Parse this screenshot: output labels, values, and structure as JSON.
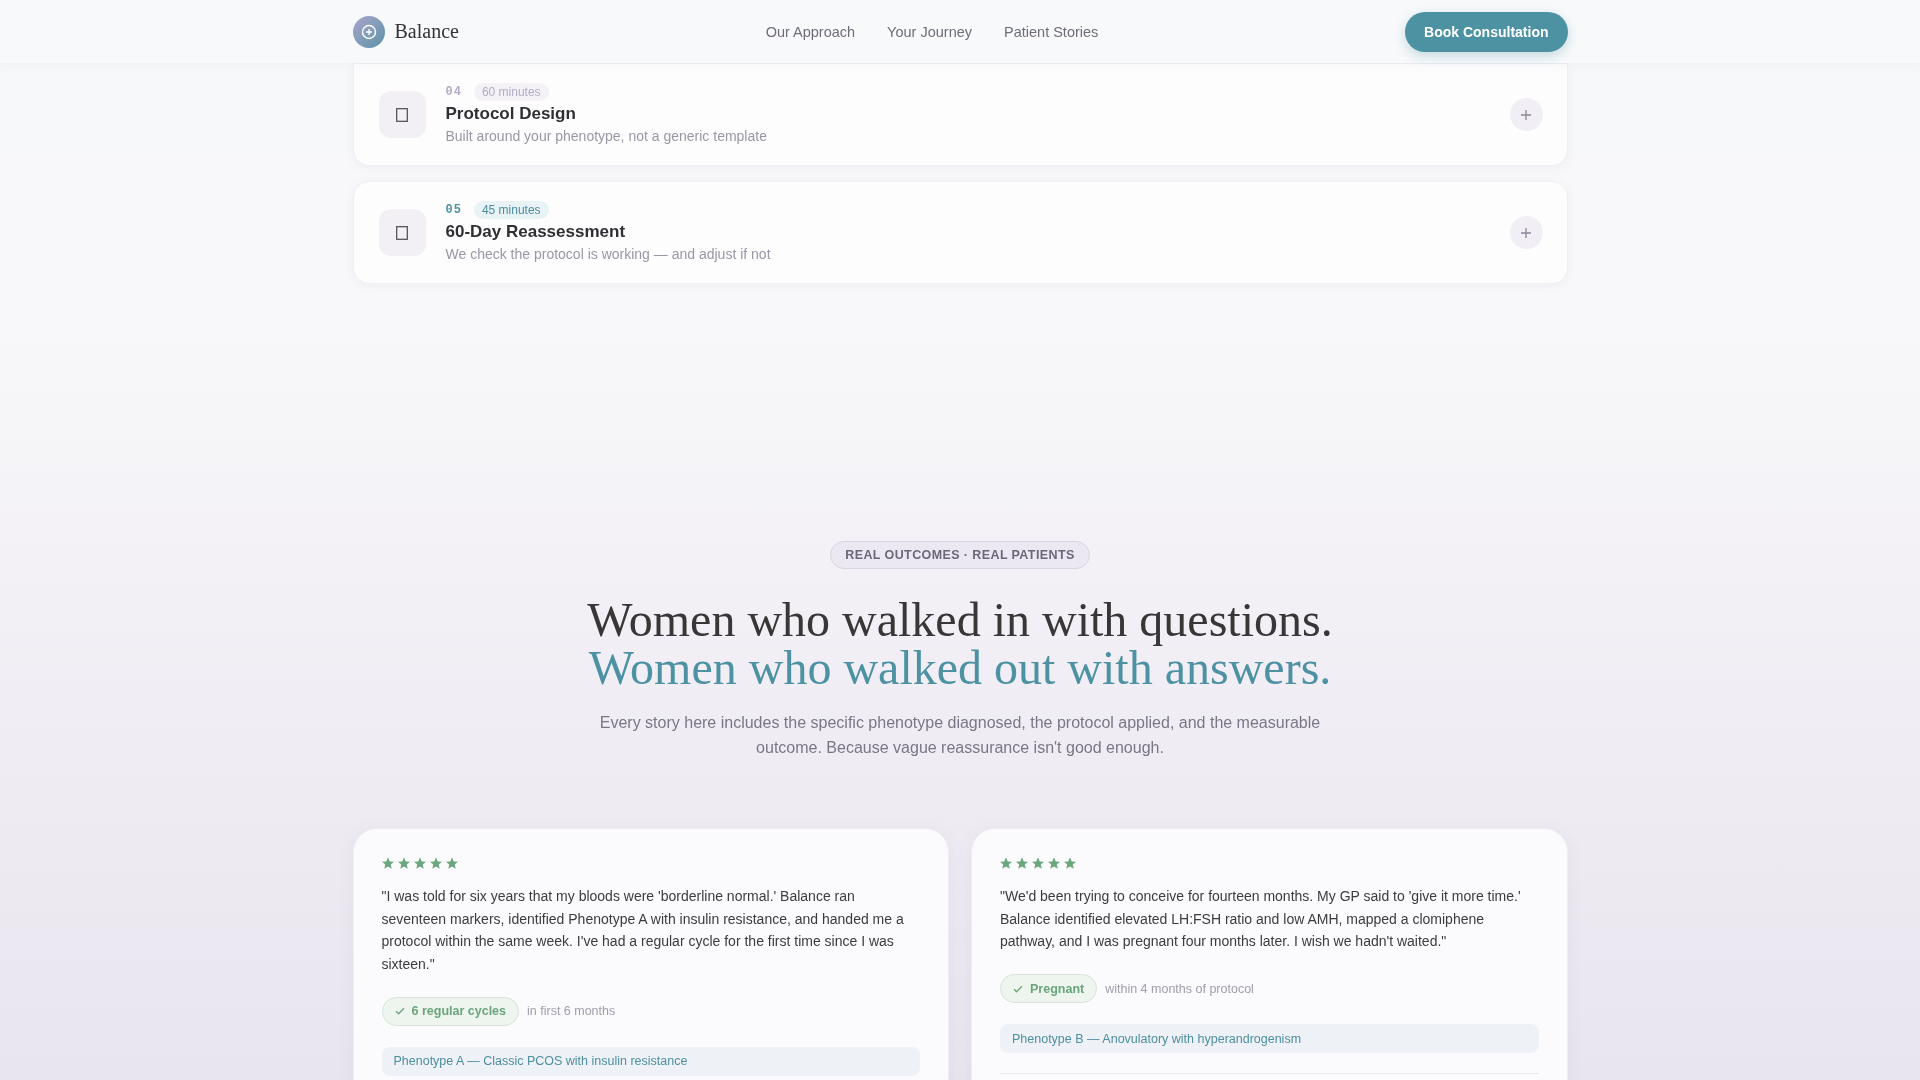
{
  "header": {
    "brand": "Balance",
    "nav": [
      {
        "label": "Our Approach"
      },
      {
        "label": "Your Journey"
      },
      {
        "label": "Patient Stories"
      }
    ],
    "cta": "Book Consultation"
  },
  "steps": [
    {
      "number": "04",
      "duration": "60 minutes",
      "title": "Protocol Design",
      "description": "Built around your phenotype, not a generic template",
      "active": false
    },
    {
      "number": "05",
      "duration": "45 minutes",
      "title": "60-Day Reassessment",
      "description": "We check the protocol is working — and adjust if not",
      "active": true
    }
  ],
  "outcomes_section": {
    "badge": "REAL OUTCOMES · REAL PATIENTS",
    "heading": "Women who walked in with questions.",
    "heading_accent": "Women who walked out with answers.",
    "intro": "Every story here includes the specific phenotype diagnosed, the protocol applied, and the measurable outcome. Because vague reassurance isn't good enough."
  },
  "testimonials": [
    {
      "stars": 5,
      "quote": "\"I was told for six years that my bloods were 'borderline normal.' Balance ran seventeen markers, identified Phenotype A with insulin resistance, and handed me a protocol within the same week. I've had a regular cycle for the first time since I was sixteen.\"",
      "outcome": "6 regular cycles",
      "outcome_note": "in first 6 months",
      "phenotype": "Phenotype A — Classic PCOS with insulin resistance"
    },
    {
      "stars": 5,
      "quote": "\"We'd been trying to conceive for fourteen months. My GP said to 'give it more time.' Balance identified elevated LH:FSH ratio and low AMH, mapped a clomiphene pathway, and I was pregnant four months later. I wish we hadn't waited.\"",
      "outcome": "Pregnant",
      "outcome_note": "within 4 months of protocol",
      "phenotype": "Phenotype B — Anovulatory with hyperandrogenism"
    }
  ]
}
